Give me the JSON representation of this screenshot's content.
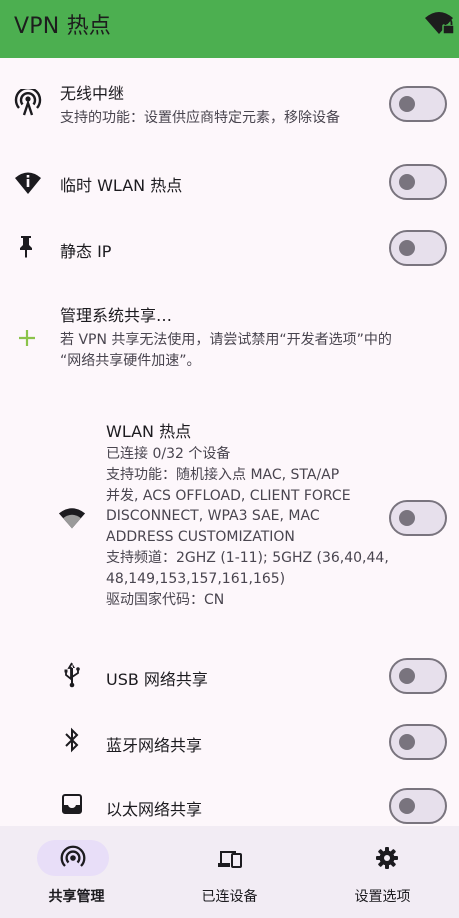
{
  "app": {
    "title": "VPN 热点"
  },
  "rows": {
    "repeater": {
      "title": "无线中继",
      "subtitle": "支持的功能：设置供应商特定元素，移除设备",
      "enabled": false
    },
    "temp_hotspot": {
      "title": "临时 WLAN 热点",
      "enabled": false
    },
    "static_ip": {
      "title": "静态 IP",
      "enabled": false
    },
    "manage": {
      "title": "管理系统共享…",
      "subtitle_1": "若 VPN 共享无法使用，请尝试禁用“开发者选项”中的",
      "subtitle_2": "“网络共享硬件加速”。"
    },
    "wlan": {
      "title": "WLAN 热点",
      "lines": [
        "已连接 0/32 个设备",
        "支持功能：随机接入点 MAC, STA/AP",
        "并发, ACS OFFLOAD, CLIENT FORCE",
        "DISCONNECT, WPA3 SAE, MAC",
        "ADDRESS CUSTOMIZATION",
        "支持频道：2GHZ (1-11); 5GHZ (36,40,44,",
        "48,149,153,157,161,165)",
        "驱动国家代码：CN"
      ],
      "enabled": false
    },
    "usb": {
      "title": "USB 网络共享",
      "enabled": false
    },
    "bluetooth": {
      "title": "蓝牙网络共享",
      "enabled": false
    },
    "ethernet": {
      "title": "以太网络共享",
      "enabled": false
    }
  },
  "nav": {
    "items": [
      {
        "label": "共享管理",
        "icon": "hotspot-icon",
        "active": true
      },
      {
        "label": "已连设备",
        "icon": "devices-icon",
        "active": false
      },
      {
        "label": "设置选项",
        "icon": "gear-icon",
        "active": false
      }
    ]
  },
  "colors": {
    "appbar": "#4caf50",
    "background": "#fdf7fb",
    "add_icon": "#8bc34a",
    "nav_pill": "#e8def8"
  }
}
